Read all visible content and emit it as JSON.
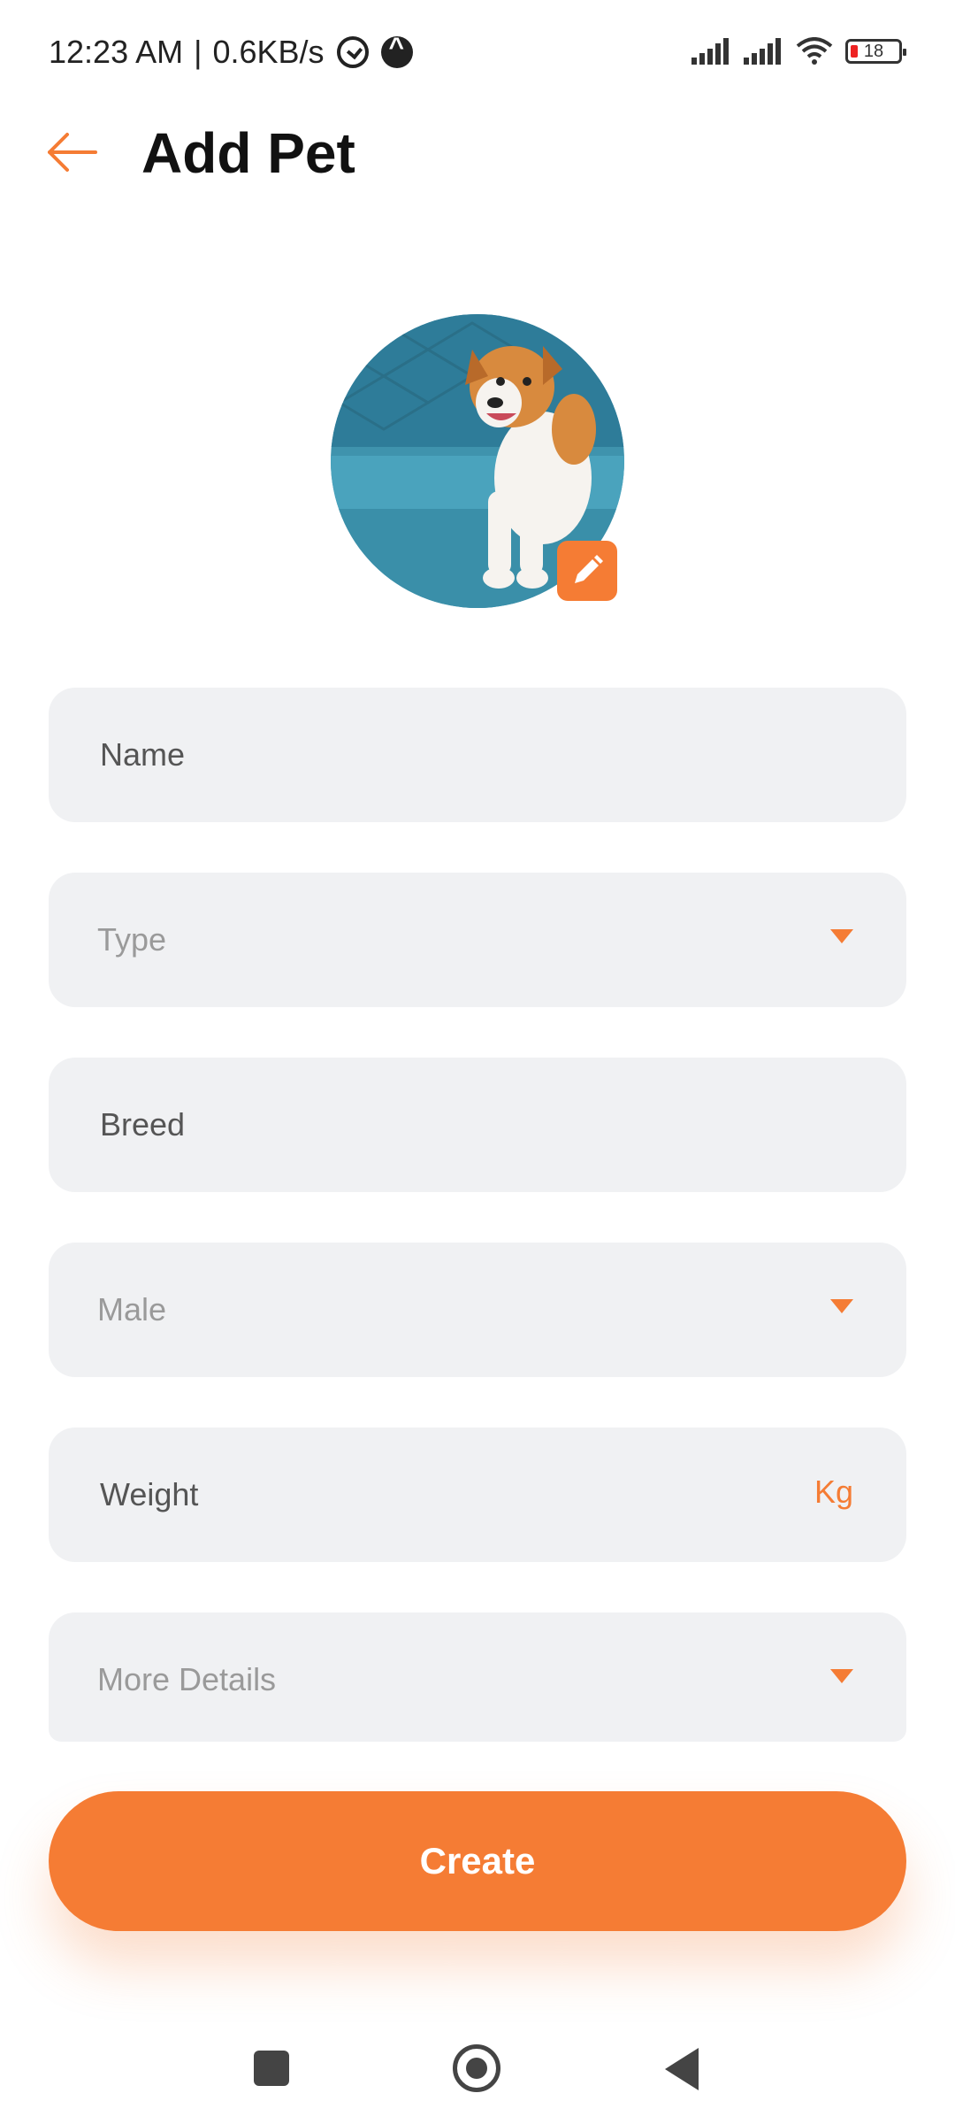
{
  "status_bar": {
    "time": "12:23 AM",
    "separator": "|",
    "network_speed": "0.6KB/s",
    "battery_level": "18",
    "icons": [
      "alarm-icon",
      "app-notification-icon",
      "signal-icon",
      "signal-icon",
      "wifi-icon",
      "battery-icon"
    ]
  },
  "header": {
    "back_icon": "arrow-left-icon",
    "title": "Add Pet"
  },
  "avatar": {
    "image": "dog-photo",
    "edit_icon": "pencil-icon"
  },
  "form": {
    "name_placeholder": "Name",
    "type_placeholder": "Type",
    "breed_placeholder": "Breed",
    "gender_value": "Male",
    "weight_placeholder": "Weight",
    "weight_unit": "Kg",
    "more_details_label": "More Details",
    "dropdown_icon": "caret-down-icon"
  },
  "actions": {
    "create_label": "Create"
  },
  "nav_bar": {
    "icons": [
      "recents-square-icon",
      "home-circle-icon",
      "back-triangle-icon"
    ]
  },
  "colors": {
    "accent": "#F57C34",
    "field_bg": "#F0F1F3",
    "placeholder": "#9A9A9A",
    "text": "#111111"
  }
}
